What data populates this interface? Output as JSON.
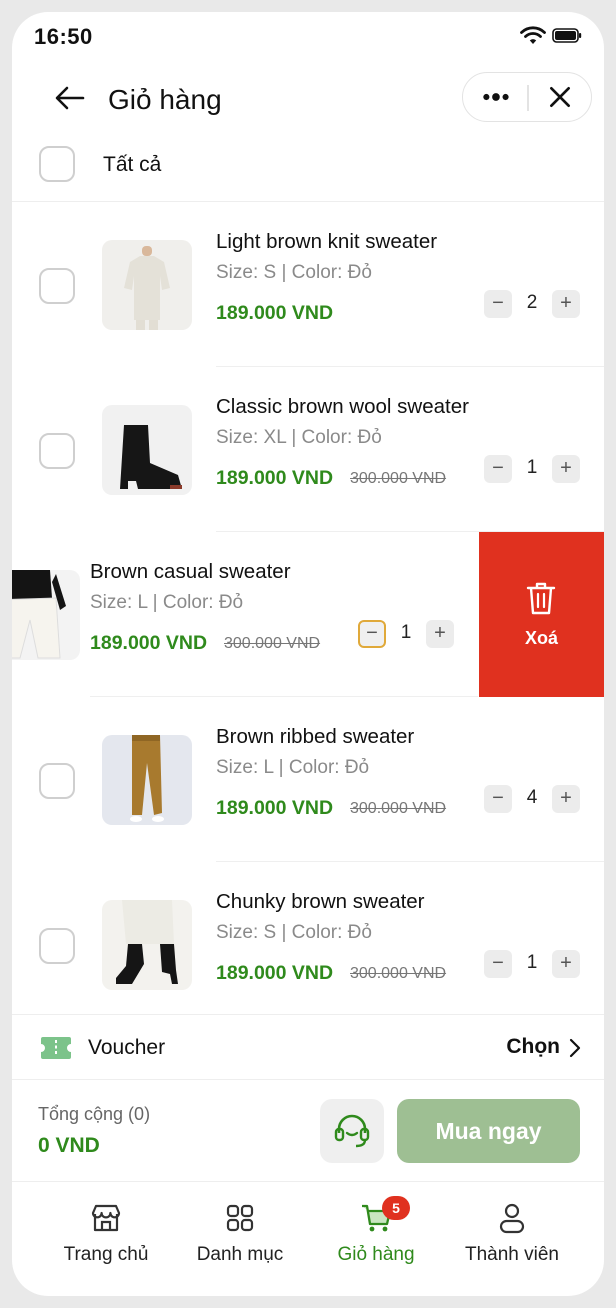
{
  "status_bar": {
    "time": "16:50"
  },
  "header": {
    "title": "Giỏ hàng"
  },
  "select_all": {
    "label": "Tất cả"
  },
  "items": [
    {
      "name": "Light brown knit sweater",
      "variant": "Size: S | Color: Đỏ",
      "price": "189.000 VND",
      "old_price": "",
      "qty": "2",
      "image": "shirt-photo"
    },
    {
      "name": "Classic brown wool sweater",
      "variant": "Size: XL | Color: Đỏ",
      "price": "189.000 VND",
      "old_price": "300.000 VND",
      "qty": "1",
      "image": "boot-photo"
    },
    {
      "name": "Brown casual sweater",
      "variant": "Size: L | Color: Đỏ",
      "price": "189.000 VND",
      "old_price": "300.000 VND",
      "qty": "1",
      "image": "shorts-photo",
      "delete_label": "Xoá"
    },
    {
      "name": "Brown ribbed sweater",
      "variant": "Size: L | Color: Đỏ",
      "price": "189.000 VND",
      "old_price": "300.000 VND",
      "qty": "4",
      "image": "pants-photo"
    },
    {
      "name": "Chunky brown sweater",
      "variant": "Size: S | Color: Đỏ",
      "price": "189.000 VND",
      "old_price": "300.000 VND",
      "qty": "1",
      "image": "boots-photo"
    }
  ],
  "voucher": {
    "label": "Voucher",
    "action": "Chọn"
  },
  "checkout": {
    "total_label": "Tổng cộng (0)",
    "total_value": "0 VND",
    "buy_label": "Mua ngay"
  },
  "tabbar": {
    "tabs": [
      {
        "label": "Trang chủ",
        "icon": "store-icon"
      },
      {
        "label": "Danh mục",
        "icon": "grid-icon"
      },
      {
        "label": "Giỏ hàng",
        "icon": "cart-icon",
        "badge": "5"
      },
      {
        "label": "Thành viên",
        "icon": "user-icon"
      }
    ]
  },
  "colors": {
    "accent_green": "#2f8a1c",
    "delete_red": "#e0311f",
    "buy_button": "#9ebf93"
  }
}
